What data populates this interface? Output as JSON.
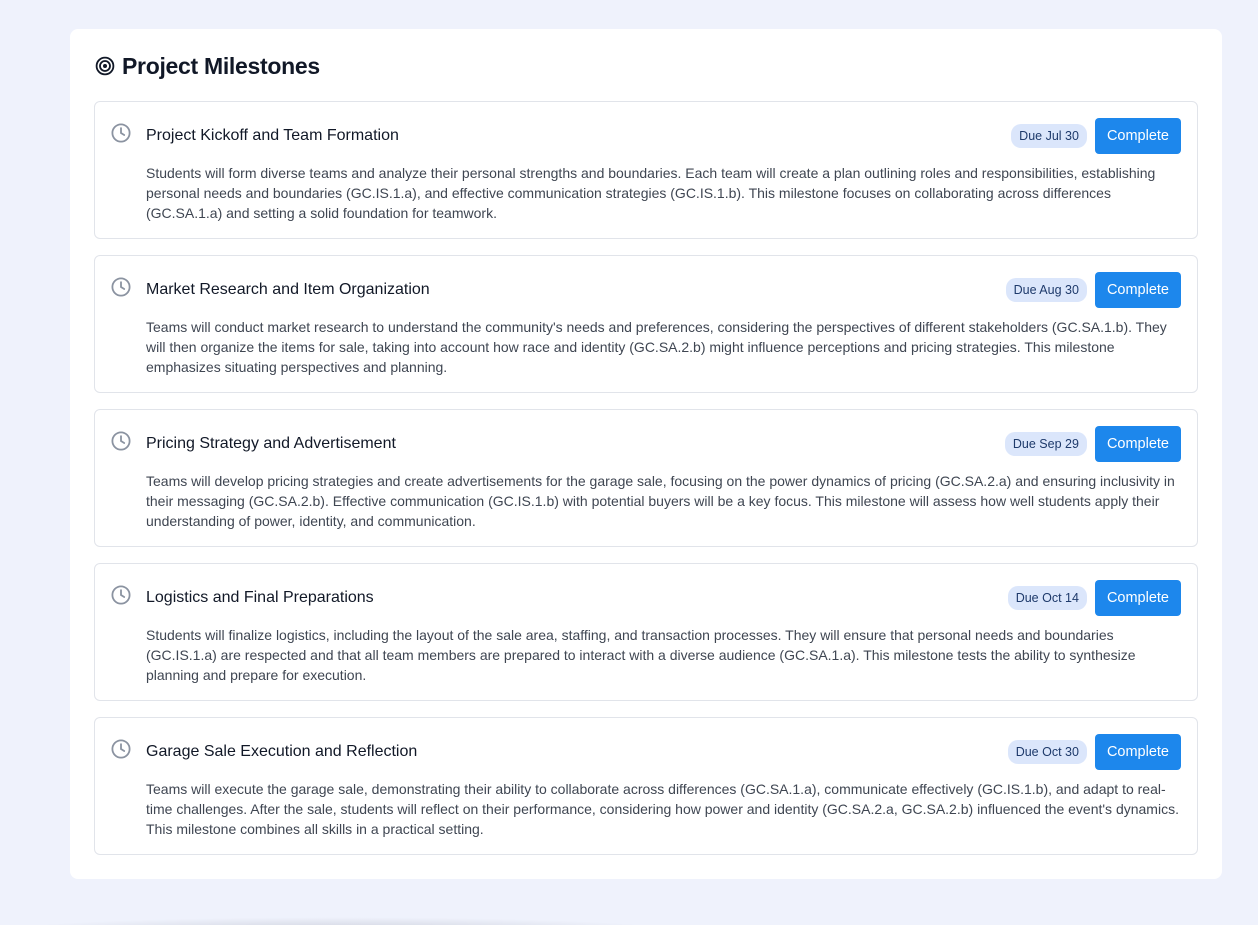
{
  "panel": {
    "title": "Project Milestones",
    "icon": "target-icon"
  },
  "colors": {
    "page_bg": "#eff2fc",
    "accent": "#1d87ec",
    "badge_bg": "#dbe6fb",
    "badge_text": "#1e3a6b"
  },
  "milestones": [
    {
      "title": "Project Kickoff and Team Formation",
      "due": "Due Jul 30",
      "button": "Complete",
      "icon": "clock-icon",
      "description": "Students will form diverse teams and analyze their personal strengths and boundaries. Each team will create a plan outlining roles and responsibilities, establishing personal needs and boundaries (GC.IS.1.a), and effective communication strategies (GC.IS.1.b). This milestone focuses on collaborating across differences (GC.SA.1.a) and setting a solid foundation for teamwork."
    },
    {
      "title": "Market Research and Item Organization",
      "due": "Due Aug 30",
      "button": "Complete",
      "icon": "clock-icon",
      "description": "Teams will conduct market research to understand the community's needs and preferences, considering the perspectives of different stakeholders (GC.SA.1.b). They will then organize the items for sale, taking into account how race and identity (GC.SA.2.b) might influence perceptions and pricing strategies. This milestone emphasizes situating perspectives and planning."
    },
    {
      "title": "Pricing Strategy and Advertisement",
      "due": "Due Sep 29",
      "button": "Complete",
      "icon": "clock-icon",
      "description": "Teams will develop pricing strategies and create advertisements for the garage sale, focusing on the power dynamics of pricing (GC.SA.2.a) and ensuring inclusivity in their messaging (GC.SA.2.b). Effective communication (GC.IS.1.b) with potential buyers will be a key focus. This milestone will assess how well students apply their understanding of power, identity, and communication."
    },
    {
      "title": "Logistics and Final Preparations",
      "due": "Due Oct 14",
      "button": "Complete",
      "icon": "clock-icon",
      "description": "Students will finalize logistics, including the layout of the sale area, staffing, and transaction processes. They will ensure that personal needs and boundaries (GC.IS.1.a) are respected and that all team members are prepared to interact with a diverse audience (GC.SA.1.a). This milestone tests the ability to synthesize planning and prepare for execution."
    },
    {
      "title": "Garage Sale Execution and Reflection",
      "due": "Due Oct 30",
      "button": "Complete",
      "icon": "clock-icon",
      "description": "Teams will execute the garage sale, demonstrating their ability to collaborate across differences (GC.SA.1.a), communicate effectively (GC.IS.1.b), and adapt to real-time challenges. After the sale, students will reflect on their performance, considering how power and identity (GC.SA.2.a, GC.SA.2.b) influenced the event's dynamics. This milestone combines all skills in a practical setting."
    }
  ]
}
